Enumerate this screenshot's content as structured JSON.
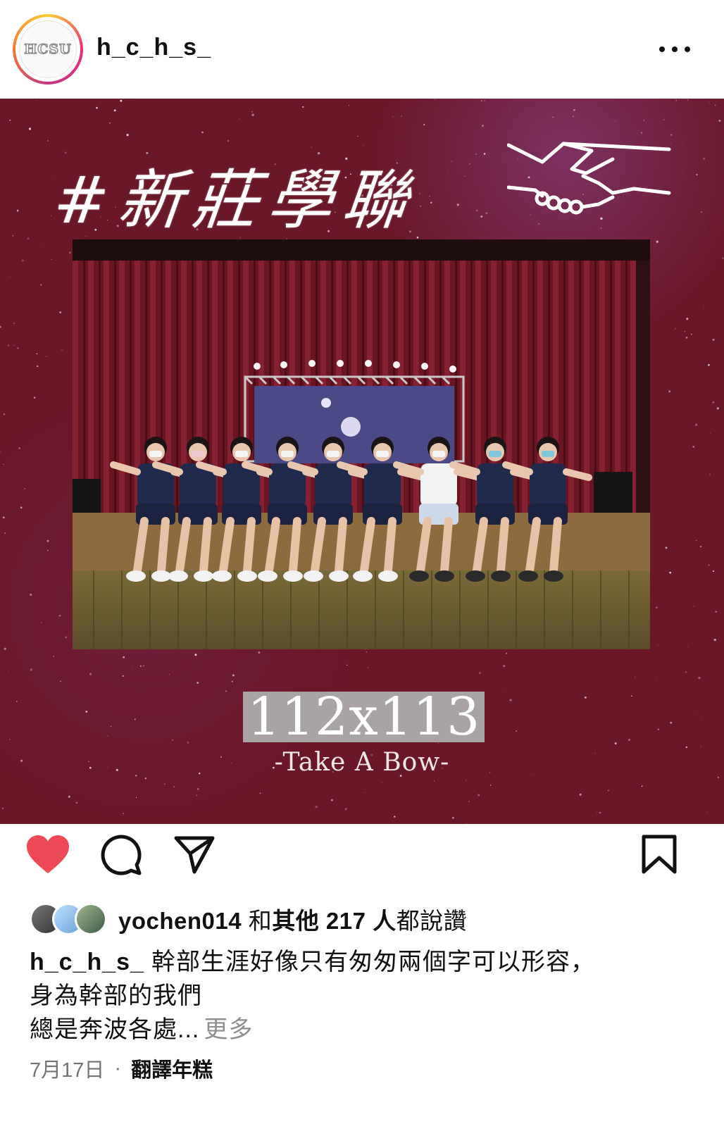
{
  "header": {
    "avatar_logo_text": "HCSU",
    "username": "h_c_h_s_"
  },
  "post": {
    "headline": "#新莊學聯",
    "year_text": "112x113",
    "tagline": "-Take A Bow-"
  },
  "actions": {
    "like_color": "#ed4956"
  },
  "likes": {
    "first_user": "yochen014",
    "connector": " 和",
    "others": "其他 217 人",
    "suffix": "都說讚"
  },
  "caption": {
    "user": "h_c_h_s_",
    "line1": "幹部生涯好像只有匆匆兩個字可以形容，",
    "line2": "身為幹部的我們",
    "line3": "總是奔波各處...",
    "more": "更多"
  },
  "footer": {
    "date": "7月17日",
    "separator": "·",
    "translate": "翻譯年糕"
  }
}
